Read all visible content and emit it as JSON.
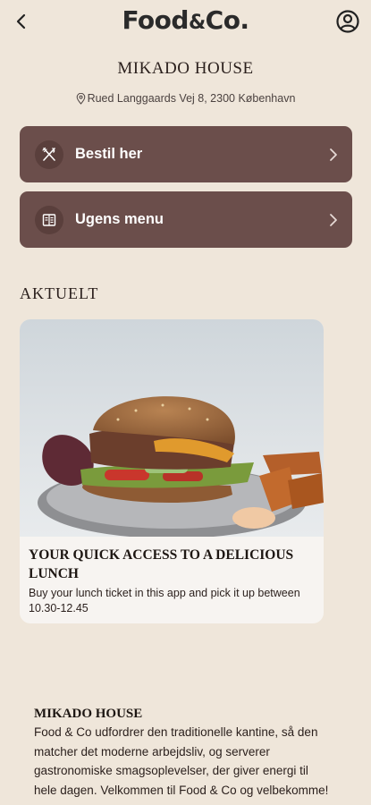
{
  "header": {
    "brand": "Food",
    "brand_amp": "&",
    "brand_suffix": "Co."
  },
  "venue": {
    "name": "MIKADO HOUSE",
    "address": "Rued Langgaards Vej 8, 2300 København"
  },
  "actions": [
    {
      "label": "Bestil her",
      "icon": "cutlery-icon"
    },
    {
      "label": "Ugens menu",
      "icon": "menu-card-icon"
    }
  ],
  "news": {
    "section_title": "AKTUELT",
    "headline": "YOUR QUICK ACCESS TO A DELICIOUS LUNCH",
    "body": "Buy your lunch ticket in this app and pick it up between 10.30-12.45"
  },
  "about": {
    "title": "MIKADO HOUSE",
    "body": "Food & Co udfordrer den traditionelle kantine, så den matcher det moderne arbejdsliv, og serverer gastronomiske smagsoplevelser, der giver energi til hele dagen. Velkommen til Food & Co og velbekomme!"
  },
  "colors": {
    "background": "#efe6da",
    "button": "#6b4e4b",
    "card": "#f7f4f1"
  }
}
